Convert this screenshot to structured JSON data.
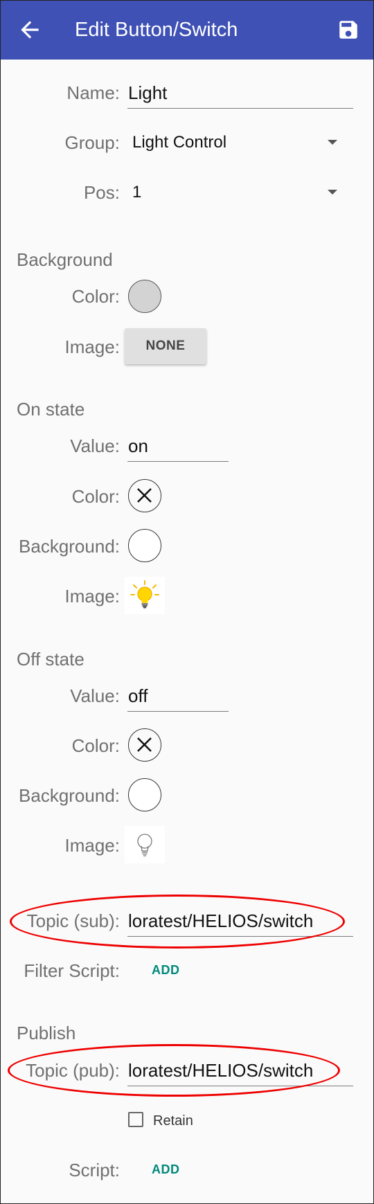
{
  "app_bar": {
    "title": "Edit Button/Switch",
    "color": "#3f51b5"
  },
  "form": {
    "name_label": "Name:",
    "name_value": "Light",
    "group_label": "Group:",
    "group_value": "Light Control",
    "pos_label": "Pos:",
    "pos_value": "1"
  },
  "background": {
    "heading": "Background",
    "color_label": "Color:",
    "color": "#d3d3d3",
    "image_label": "Image:",
    "image_button": "NONE"
  },
  "on_state": {
    "heading": "On state",
    "value_label": "Value:",
    "value": "on",
    "color_label": "Color:",
    "background_label": "Background:",
    "image_label": "Image:",
    "image_icon": "lightbulb-on-icon"
  },
  "off_state": {
    "heading": "Off state",
    "value_label": "Value:",
    "value": "off",
    "color_label": "Color:",
    "background_label": "Background:",
    "image_label": "Image:",
    "image_icon": "lightbulb-off-icon"
  },
  "subscribe": {
    "topic_label": "Topic (sub):",
    "topic_value": "loratest/HELIOS/switch",
    "filter_label": "Filter Script:",
    "filter_action": "ADD"
  },
  "publish": {
    "heading": "Publish",
    "topic_label": "Topic (pub):",
    "topic_value": "loratest/HELIOS/switch",
    "retain_label": "Retain",
    "retain_checked": false,
    "script_label": "Script:",
    "script_action": "ADD"
  },
  "colors": {
    "accent_teal": "#00897b",
    "annotation_red": "#e00000"
  }
}
